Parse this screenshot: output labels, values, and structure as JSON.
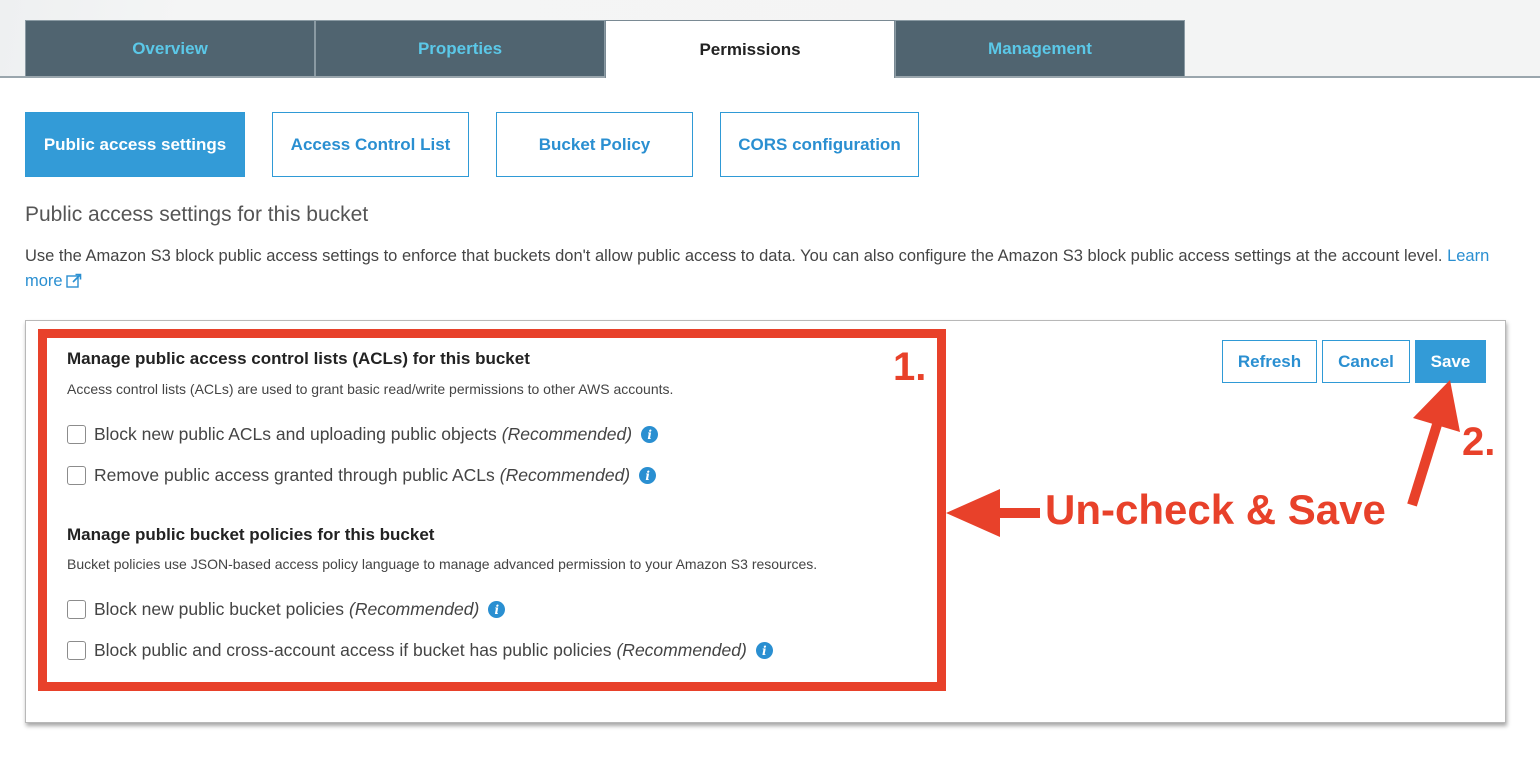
{
  "tabs": [
    {
      "label": "Overview",
      "active": false
    },
    {
      "label": "Properties",
      "active": false
    },
    {
      "label": "Permissions",
      "active": true
    },
    {
      "label": "Management",
      "active": false
    }
  ],
  "subtabs": [
    {
      "label": "Public access settings",
      "active": true
    },
    {
      "label": "Access Control List",
      "active": false
    },
    {
      "label": "Bucket Policy",
      "active": false
    },
    {
      "label": "CORS configuration",
      "active": false
    }
  ],
  "section": {
    "title": "Public access settings for this bucket",
    "description": "Use the Amazon S3 block public access settings to enforce that buckets don't allow public access to data. You can also configure the Amazon S3 block public access settings at the account level.",
    "learn_more": "Learn more",
    "learn_more_icon": "external-link-icon"
  },
  "panel": {
    "buttons": {
      "refresh": "Refresh",
      "cancel": "Cancel",
      "save": "Save"
    },
    "groups": [
      {
        "title": "Manage public access control lists (ACLs) for this bucket",
        "description": "Access control lists (ACLs) are used to grant basic read/write permissions to other AWS accounts.",
        "options": [
          {
            "label": "Block new public ACLs and uploading public objects",
            "note": "(Recommended)",
            "checked": false,
            "icon": "info-icon"
          },
          {
            "label": "Remove public access granted through public ACLs",
            "note": "(Recommended)",
            "checked": false,
            "icon": "info-icon"
          }
        ]
      },
      {
        "title": "Manage public bucket policies for this bucket",
        "description": "Bucket policies use JSON-based access policy language to manage advanced permission to your Amazon S3 resources.",
        "options": [
          {
            "label": "Block new public bucket policies",
            "note": "(Recommended)",
            "checked": false,
            "icon": "info-icon"
          },
          {
            "label": "Block public and cross-account access if bucket has public policies",
            "note": "(Recommended)",
            "checked": false,
            "icon": "info-icon"
          }
        ]
      }
    ]
  },
  "annotations": {
    "step1": "1.",
    "step2": "2.",
    "instruction": "Un-check & Save",
    "color": "#e8412a"
  },
  "colors": {
    "tab_bg": "#506470",
    "tab_text": "#5bc8e8",
    "accent": "#339bd7",
    "link": "#2a8fd1"
  }
}
